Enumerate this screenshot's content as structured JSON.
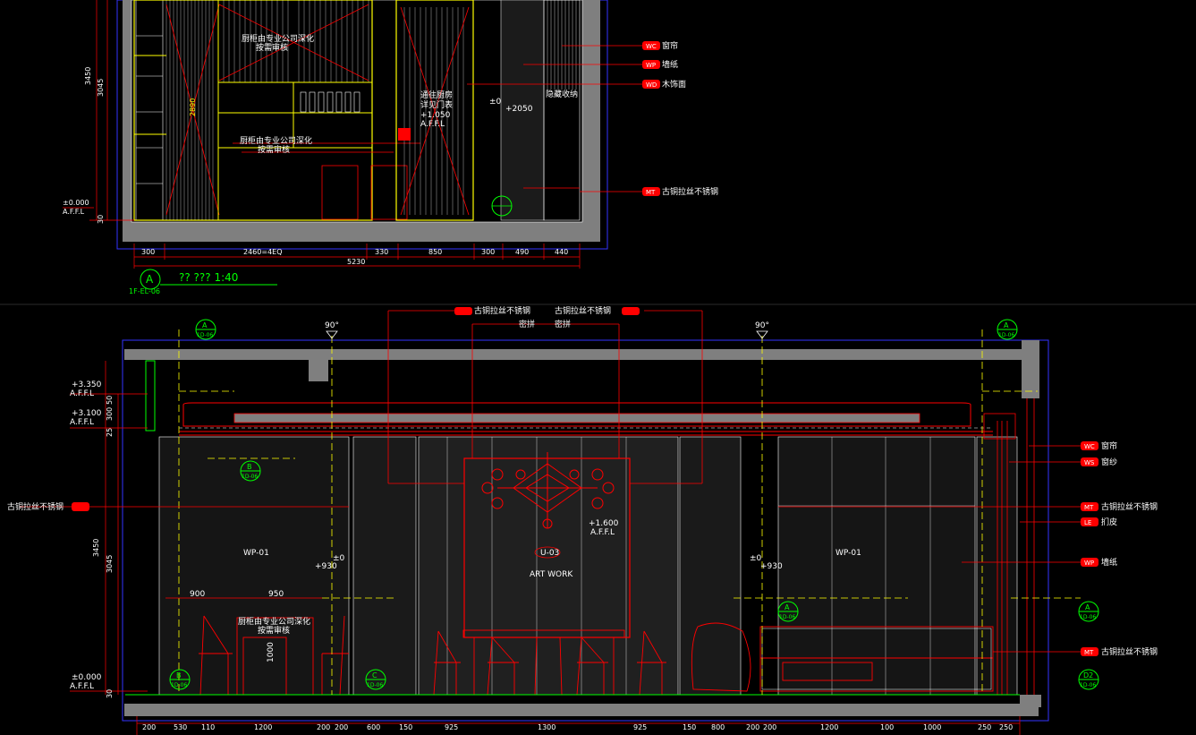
{
  "drawing_a": {
    "dims_bottom": [
      "300",
      "2460=4EQ",
      "330",
      "850",
      "300",
      "490",
      "440"
    ],
    "dim_total": "5230",
    "dims_left": [
      "3450",
      "3045",
      "30"
    ],
    "dim_inner": "2890",
    "level_zero": "±0.000",
    "affl": "A.F.F.L",
    "title_marker": "A",
    "title_ref": "1F-EL-06",
    "title_text": "?? ???  1:40",
    "notes": {
      "cabinet_top": "厨柜由专业公司深化",
      "cabinet_top2": "按需审核",
      "cabinet_mid": "厨柜由专业公司深化",
      "cabinet_mid2": "按需审核",
      "door_note1": "通往厨房",
      "door_note2": "详见门表",
      "door_level": "+1.050",
      "door_affl": "A.F.F.L",
      "level_2050": "+2050",
      "level_0": "±0",
      "hidden_cabinet": "隐藏收纳"
    },
    "callouts": [
      {
        "tag": "WC",
        "label": "窗帘"
      },
      {
        "tag": "WP",
        "label": "墙纸"
      },
      {
        "tag": "WD",
        "label": "木饰面"
      },
      {
        "tag": "MT",
        "label": "古铜拉丝不锈钢"
      }
    ]
  },
  "drawing_b": {
    "angle_left": "90°",
    "angle_right": "90°",
    "top_callout_left": "古铜拉丝不锈钢",
    "top_callout_right": "古铜拉丝不锈钢",
    "top_sub_left": "密拼",
    "top_sub_right": "密拼",
    "left_callout": "古铜拉丝不锈钢",
    "levels": [
      "+3.350",
      "A.F.F.L",
      "+3.100",
      "A.F.F.L",
      "±0.000",
      "A.F.F.L"
    ],
    "dims_left": [
      "3450",
      "3045",
      "25",
      "300",
      "50",
      "30"
    ],
    "dims_bottom": [
      "200",
      "530",
      "110",
      "1200",
      "200",
      "200",
      "600",
      "150",
      "925",
      "1300",
      "925",
      "150",
      "800",
      "200",
      "200",
      "1200",
      "100",
      "1000",
      "250",
      "250"
    ],
    "dims_inner": [
      "900",
      "950"
    ],
    "wall_tags": [
      "WP-01",
      "WP-01"
    ],
    "artwork_tag": "U-03",
    "artwork_label": "ART WORK",
    "artwork_level": "+1.600",
    "artwork_affl": "A.F.F.L",
    "level_0_left": "±0",
    "level_930_left": "+930",
    "level_0_right": "±0",
    "level_930_right": "+930",
    "cabinet_note1": "厨柜由专业公司深化",
    "cabinet_note2": "按需审核",
    "cabinet_dim": "1000",
    "callouts_right": [
      {
        "tag": "WC",
        "label": "窗帘"
      },
      {
        "tag": "WS",
        "label": "窗纱"
      },
      {
        "tag": "MT",
        "label": "古铜拉丝不锈钢"
      },
      {
        "tag": "LE",
        "label": "扪皮"
      },
      {
        "tag": "WP",
        "label": "墙纸"
      },
      {
        "tag": "MT",
        "label": "古铜拉丝不锈钢"
      }
    ],
    "markers": [
      {
        "top": "A",
        "bottom": "1D-06"
      },
      {
        "top": "A",
        "bottom": "1D-06"
      },
      {
        "top": "B",
        "bottom": "1D-06"
      },
      {
        "top": "A",
        "bottom": "1D-06"
      },
      {
        "top": "A",
        "bottom": "1D-06"
      },
      {
        "top": "B",
        "bottom": "1D-06"
      },
      {
        "top": "C",
        "bottom": "1D-06"
      },
      {
        "top": "D2",
        "bottom": "1D-06"
      }
    ]
  },
  "colors": {
    "background": "#000000",
    "wall_fill": "#7f7f7f",
    "line_red": "#ff0000",
    "line_yellow": "#ffff00",
    "line_white": "#ffffff",
    "line_green": "#00ff00",
    "frame_blue": "#3333ff"
  }
}
